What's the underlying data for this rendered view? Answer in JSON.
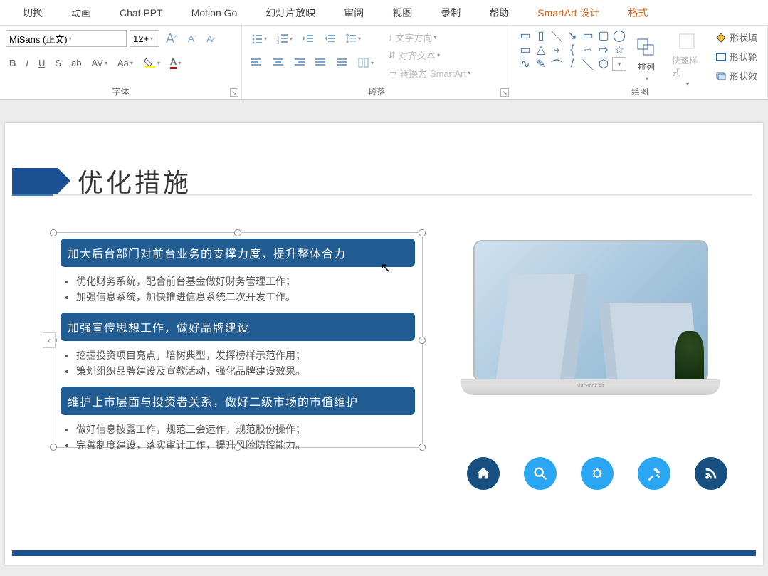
{
  "tabs": [
    "切换",
    "动画",
    "Chat PPT",
    "Motion Go",
    "幻灯片放映",
    "审阅",
    "视图",
    "录制",
    "帮助",
    "SmartArt 设计",
    "格式"
  ],
  "active_tab_indexes": [
    9,
    10
  ],
  "font": {
    "family": "MiSans (正文)",
    "size": "12+",
    "increase_tip": "A",
    "decrease_tip": "A",
    "group_label": "字体"
  },
  "paragraph": {
    "text_direction": "文字方向",
    "align_text": "对齐文本",
    "convert_smartart": "转换为 SmartArt",
    "group_label": "段落"
  },
  "drawing": {
    "arrange": "排列",
    "quick_styles": "快速样式",
    "shape_fill": "形状填",
    "shape_outline": "形状轮",
    "shape_effects": "形状效",
    "group_label": "绘图"
  },
  "slide": {
    "title": "优化措施",
    "items": [
      {
        "header": "加大后台部门对前台业务的支撑力度，提升整体合力",
        "bullets": [
          "优化财务系统，配合前台基金做好财务管理工作；",
          "加强信息系统，加快推进信息系统二次开发工作。"
        ]
      },
      {
        "header": "加强宣传思想工作，做好品牌建设",
        "bullets": [
          "挖掘投资项目亮点，培树典型，发挥榜样示范作用；",
          "策划组织品牌建设及宣教活动，强化品牌建设效果。"
        ]
      },
      {
        "header": "维护上市层面与投资者关系，做好二级市场的市值维护",
        "bullets": [
          "做好信息披露工作，规范三会运作，规范股份操作；",
          "完善制度建设，落实审计工作，提升风险防控能力。"
        ]
      }
    ],
    "laptop_label": "MacBook Air",
    "icons": [
      "home-icon",
      "search-icon",
      "gear-icon",
      "tools-icon",
      "rss-icon"
    ]
  }
}
